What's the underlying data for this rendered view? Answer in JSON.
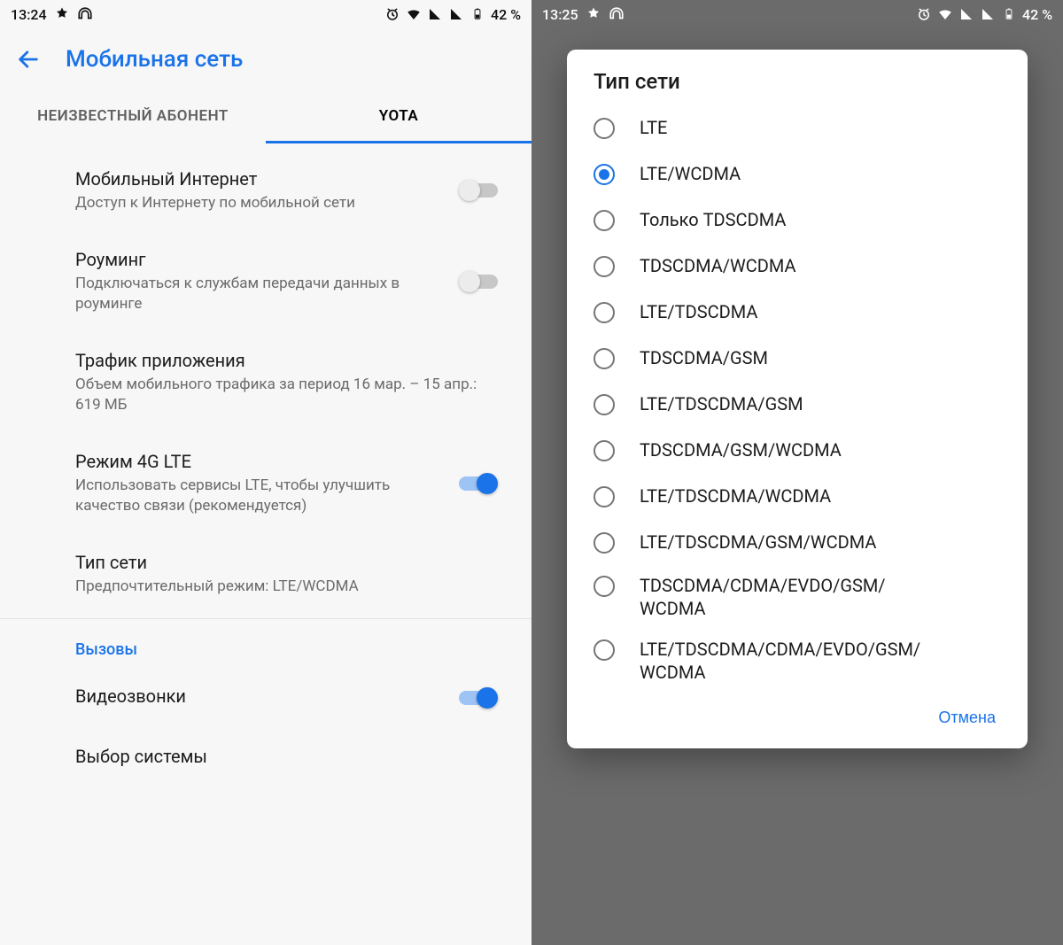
{
  "left": {
    "status": {
      "time": "13:24",
      "battery": "42 %"
    },
    "title": "Мобильная сеть",
    "tabs": [
      {
        "label": "НЕИЗВЕСТНЫЙ АБОНЕНТ",
        "active": false
      },
      {
        "label": "YOTA",
        "active": true
      }
    ],
    "rows": {
      "mobile_data": {
        "title": "Мобильный Интернет",
        "sub": "Доступ к Интернету по мобильной сети",
        "on": false
      },
      "roaming": {
        "title": "Роуминг",
        "sub": "Подключаться к службам передачи данных в роуминге",
        "on": false
      },
      "app_traffic": {
        "title": "Трафик приложения",
        "sub": "Объем мобильного трафика за период 16 мар. – 15 апр.: 619 МБ"
      },
      "lte_mode": {
        "title": "Режим 4G LTE",
        "sub": "Использовать сервисы LTE, чтобы улучшить качество связи (рекомендуется)",
        "on": true
      },
      "net_type": {
        "title": "Тип сети",
        "sub": "Предпочтительный режим: LTE/WCDMA"
      }
    },
    "section_calls": "Вызовы",
    "video_calls": {
      "title": "Видеозвонки",
      "on": true
    },
    "system_select": {
      "title": "Выбор системы"
    }
  },
  "right": {
    "status": {
      "time": "13:25",
      "battery": "42 %"
    },
    "dialog": {
      "title": "Тип сети",
      "options": [
        "LTE",
        "LTE/WCDMA",
        "Только TDSCDMA",
        "TDSCDMA/WCDMA",
        "LTE/TDSCDMA",
        "TDSCDMA/GSM",
        "LTE/TDSCDMA/GSM",
        "TDSCDMA/GSM/WCDMA",
        "LTE/TDSCDMA/WCDMA",
        "LTE/TDSCDMA/GSM/WCDMA",
        "TDSCDMA/CDMA/EVDO/GSM/WCDMA",
        "LTE/TDSCDMA/CDMA/EVDO/GSM/WCDMA"
      ],
      "selected_index": 1,
      "cancel": "Отмена"
    }
  }
}
